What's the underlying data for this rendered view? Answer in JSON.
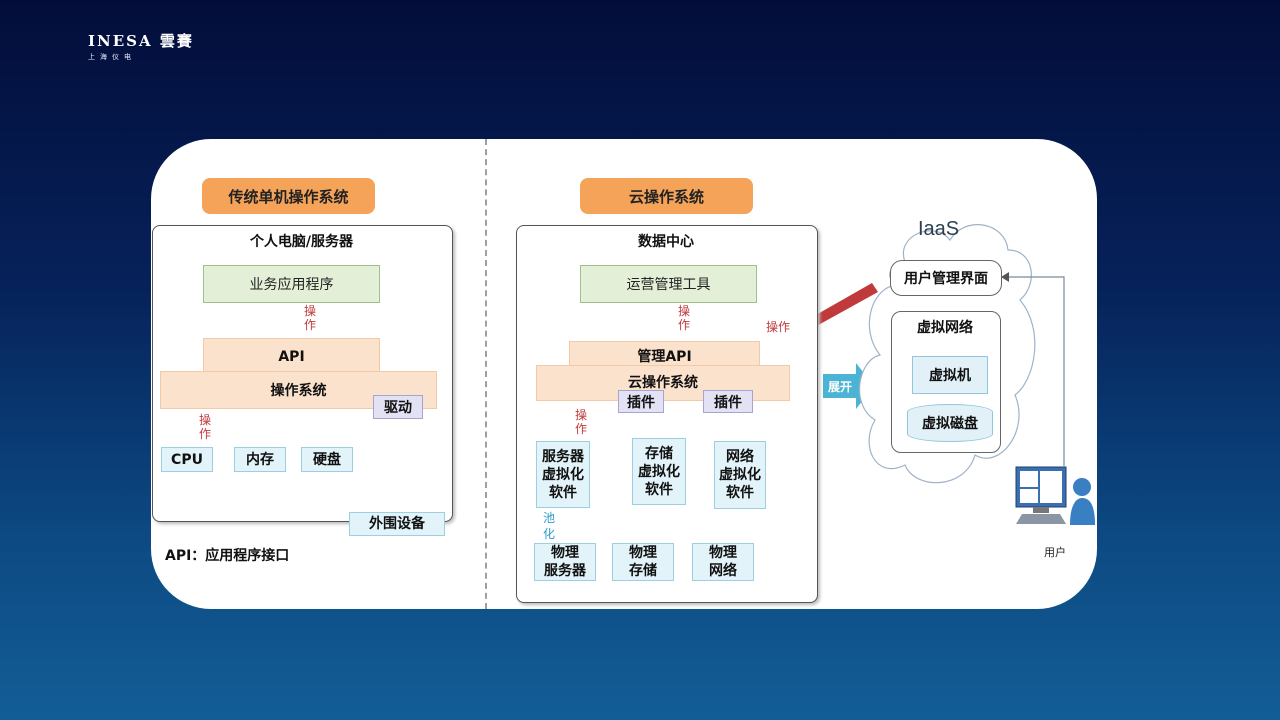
{
  "logo": {
    "brand": "INESA 雲賽",
    "sub": "上海仪电"
  },
  "left": {
    "pill": "传统单机操作系统",
    "frame_title": "个人电脑/服务器",
    "app": "业务应用程序",
    "op1": [
      "操",
      "作"
    ],
    "api": "API",
    "os": "操作系统",
    "driver": "驱动",
    "op2": [
      "操",
      "作"
    ],
    "cpu": "CPU",
    "memory": "内存",
    "disk": "硬盘",
    "peripheral": "外围设备",
    "footnote": "API：应用程序接口"
  },
  "middle": {
    "pill": "云操作系统",
    "frame_title": "数据中心",
    "tool": "运营管理工具",
    "op1": [
      "操",
      "作"
    ],
    "op_right": "操作",
    "mgmt_api": "管理API",
    "cloud_os": "云操作系统",
    "plugin1": "插件",
    "plugin2": "插件",
    "op2": [
      "操",
      "作"
    ],
    "server_virt": [
      "服务器",
      "虚拟化",
      "软件"
    ],
    "storage_virt": [
      "存储",
      "虚拟化",
      "软件"
    ],
    "network_virt": [
      "网络",
      "虚拟化",
      "软件"
    ],
    "pool": [
      "池",
      "化"
    ],
    "phys_server": [
      "物理",
      "服务器"
    ],
    "phys_storage": [
      "物理",
      "存储"
    ],
    "phys_network": [
      "物理",
      "网络"
    ]
  },
  "right": {
    "expand": "展开",
    "iaas": "IaaS",
    "user_ui": "用户管理界面",
    "vnet": "虚拟网络",
    "vm": "虚拟机",
    "vdisk": "虚拟磁盘",
    "user": "用户"
  },
  "colors": {
    "arrow_red": "#c0393b",
    "arrow_blue": "#4bb3d3",
    "pill": "#f6a35a"
  }
}
